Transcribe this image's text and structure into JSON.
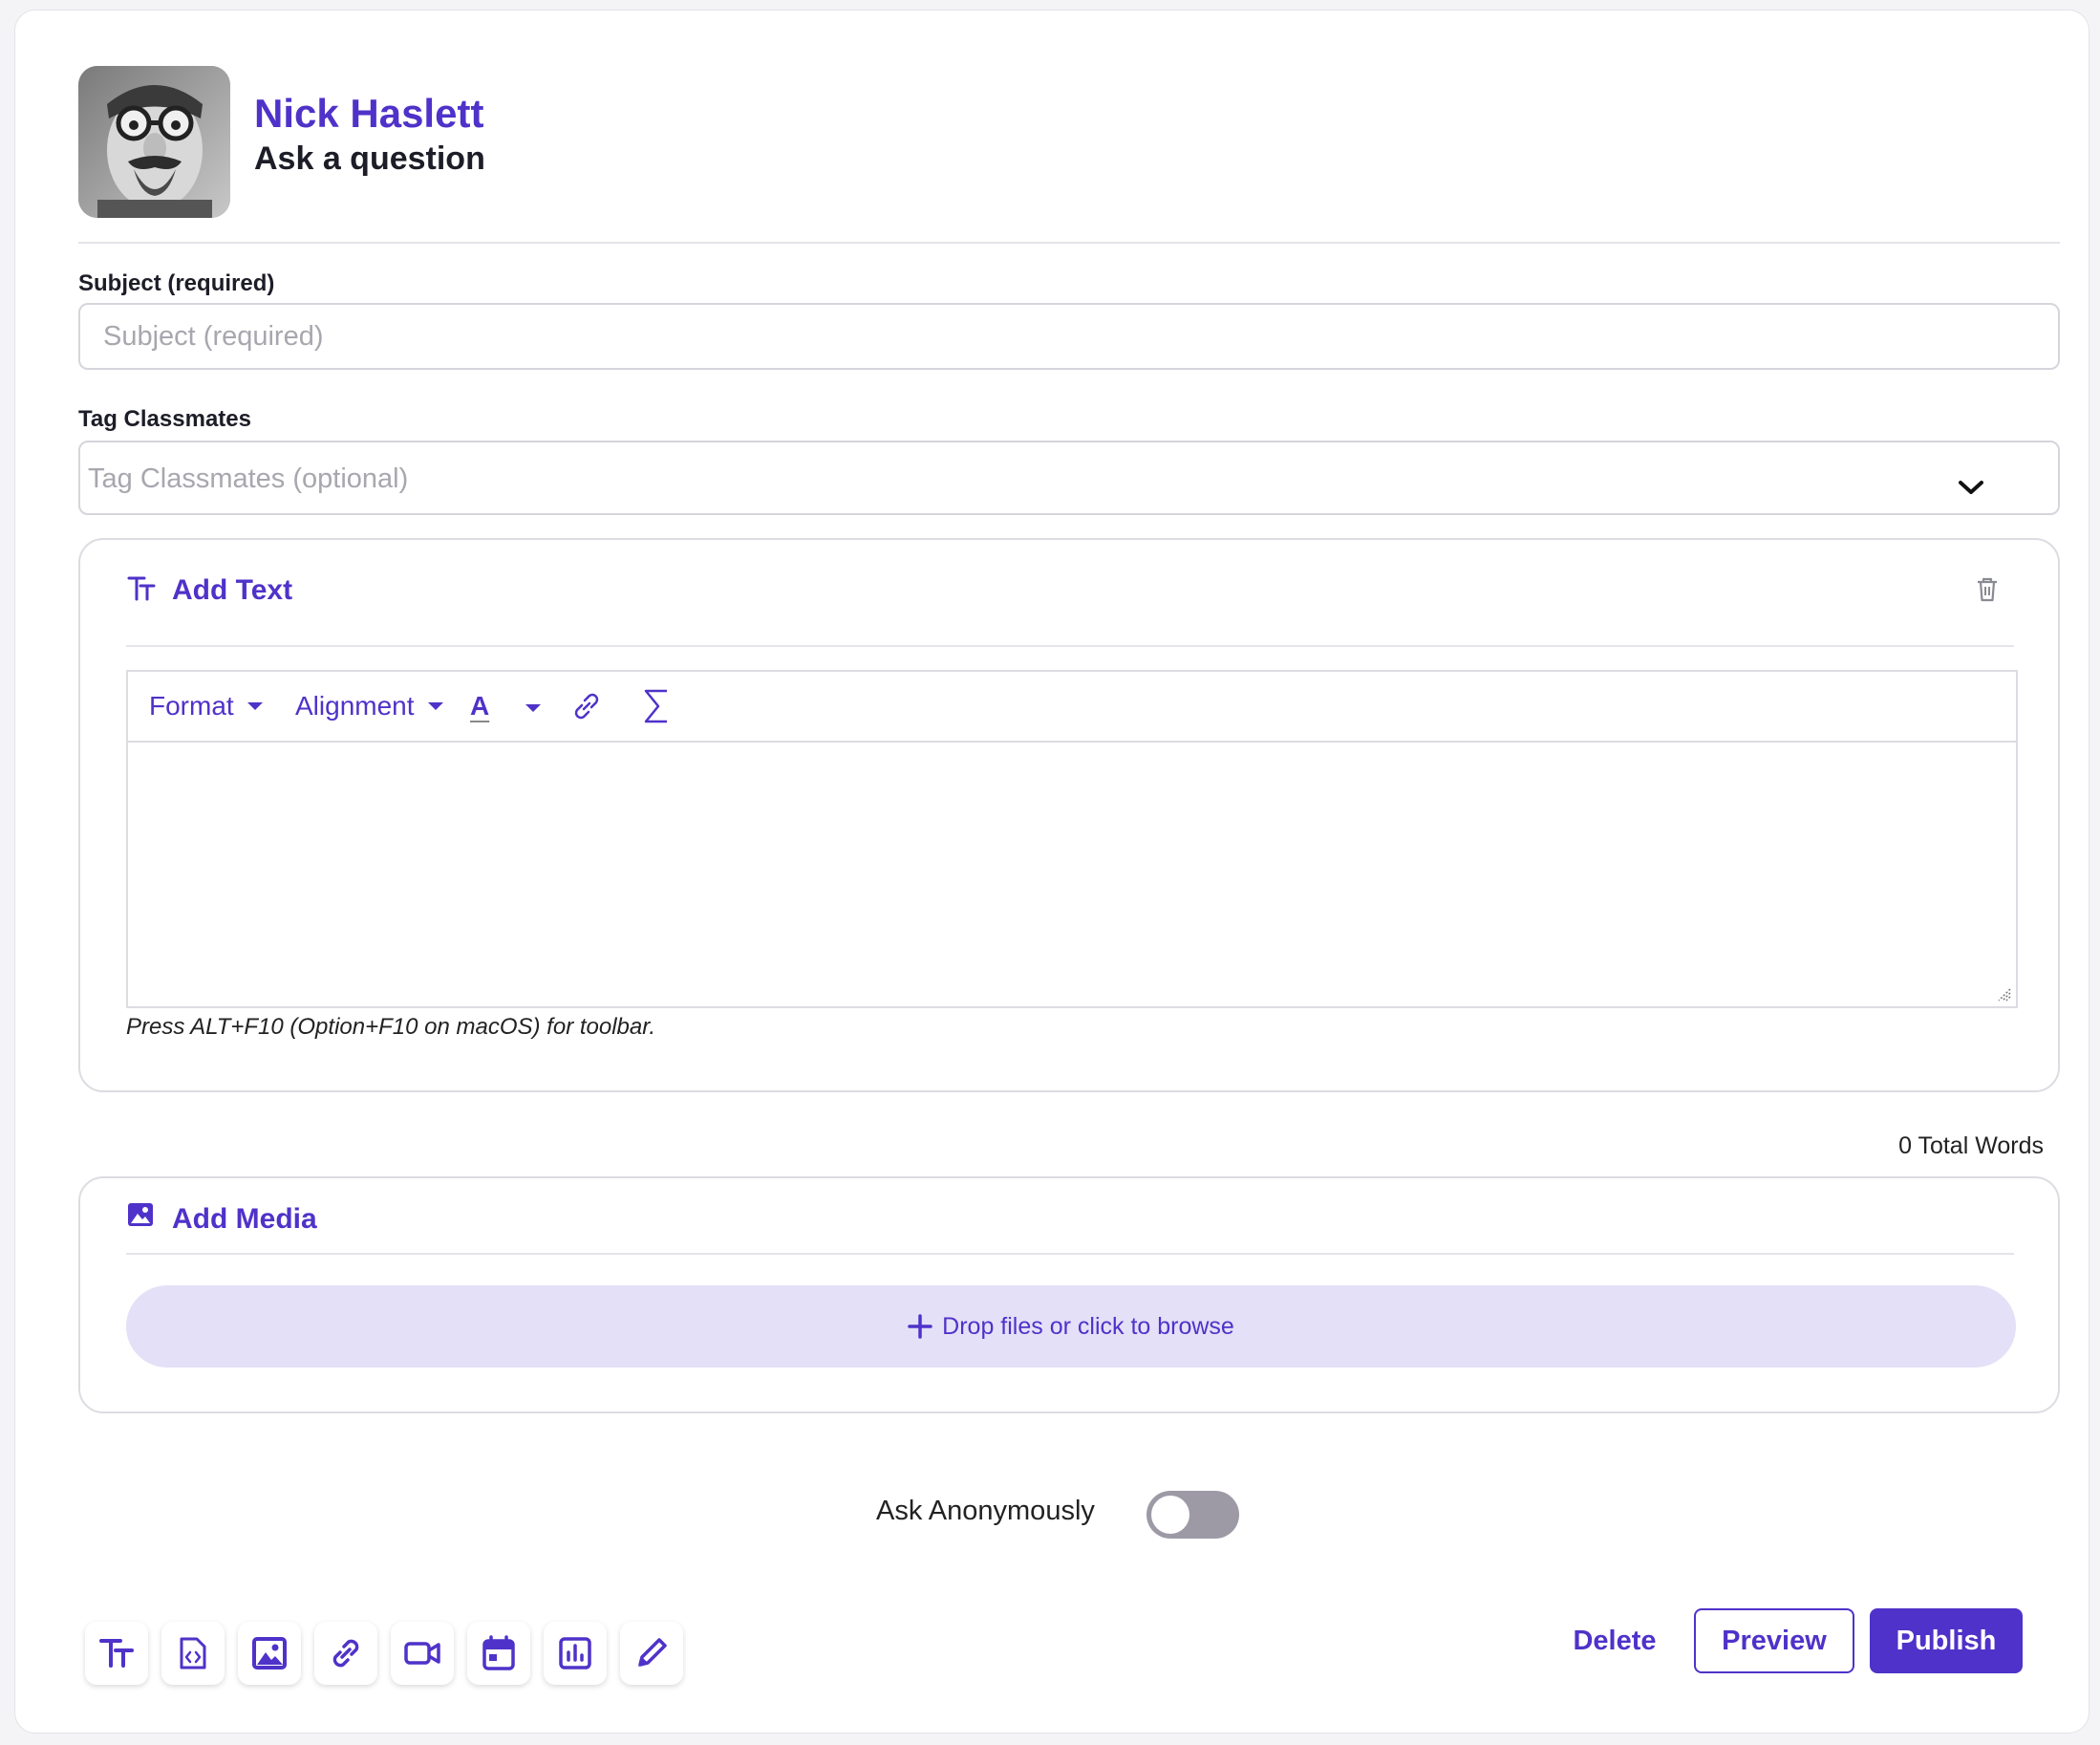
{
  "header": {
    "user_name": "Nick Haslett",
    "subtitle": "Ask a question"
  },
  "subject": {
    "label": "Subject (required)",
    "placeholder": "Subject (required)",
    "value": ""
  },
  "tags": {
    "label": "Tag Classmates",
    "placeholder": "Tag Classmates (optional)"
  },
  "text_section": {
    "title": "Add Text",
    "toolbar": {
      "format_label": "Format",
      "alignment_label": "Alignment",
      "font_color_label": "A"
    },
    "hint": "Press ALT+F10 (Option+F10 on macOS) for toolbar."
  },
  "word_count": "0 Total Words",
  "media_section": {
    "title": "Add Media",
    "drop_label": "Drop files or click to browse"
  },
  "anonymous": {
    "label": "Ask Anonymously",
    "enabled": false
  },
  "add_blocks": [
    "text-icon",
    "code-file-icon",
    "image-icon",
    "link-icon",
    "video-icon",
    "calendar-icon",
    "chart-icon",
    "pencil-icon"
  ],
  "actions": {
    "delete_label": "Delete",
    "preview_label": "Preview",
    "publish_label": "Publish"
  },
  "colors": {
    "accent": "#4f32c9",
    "drop_zone_bg": "#e4e0f7",
    "toggle_off": "#9d9aa6"
  }
}
